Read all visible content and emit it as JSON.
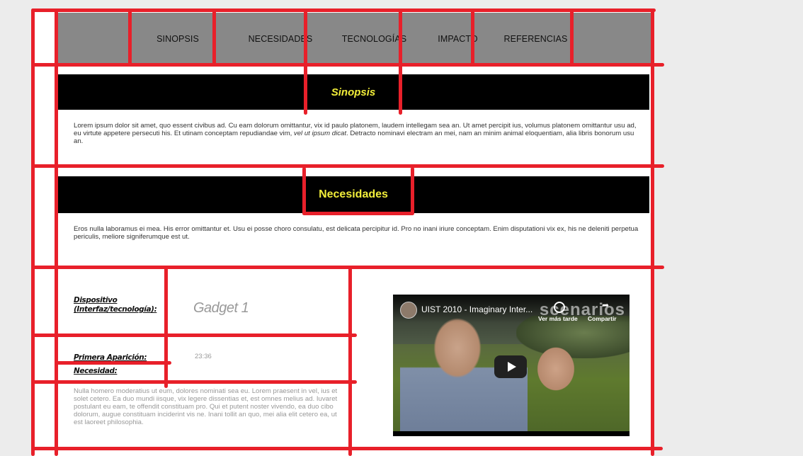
{
  "nav": {
    "items": [
      "SINOPSIS",
      "NECESIDADES",
      "TECNOLOGÍAS",
      "IMPACTO",
      "REFERENCIAS"
    ]
  },
  "sinopsis": {
    "title": "Sinopsis",
    "text_before": "Lorem ipsum dolor sit amet, quo essent civibus ad. Cu eam dolorum omittantur, vix id paulo platonem, laudem intellegam sea an. Ut amet percipit ius, volumus platonem omittantur usu ad, eu virtute appetere persecuti his. Et utinam conceptam repudiandae vim, ",
    "text_em": "vel ut ipsum dicat",
    "text_after": ". Detracto nominavi electram an mei, nam an minim animal eloquentiam, alia libris bonorum usu an."
  },
  "necesidades": {
    "title": "Necesidades",
    "text": "Eros nulla laboramus ei mea. His error omittantur et. Usu ei posse choro consulatu, est delicata percipitur id. Pro no inani iriure conceptam. Enim disputationi vix ex, his ne deleniti perpetua periculis, meliore signiferumque est ut."
  },
  "detail": {
    "dispositivo_label_1": "Dispositivo",
    "dispositivo_label_2": "(Interfaz/tecnología):",
    "dispositivo_value": "Gadget 1",
    "aparicion_label": "Primera Aparición:",
    "aparicion_value": "23:36",
    "necesidad_label": "Necesidad:",
    "necesidad_text": "Nulla homero moderatius ut eum, dolores nominati sea eu. Lorem praesent in vel, ius et solet cetero. Ea duo mundi iisque, vix legere dissentias et, est omnes melius ad. Iuvaret postulant eu eam, te offendit constituam pro. Qui et putent noster vivendo, ea duo cibo dolorum, augue constituam inciderint vis ne. Inani tollit an quo, mei alia elit cetero ea, ut est laoreet philosophia."
  },
  "video": {
    "title": "UIST 2010 - Imaginary Inter...",
    "brand": "scenarios",
    "watch_later": "Ver más tarde",
    "share": "Compartir"
  },
  "colors": {
    "nav_bg": "#888888",
    "bar_bg": "#000000",
    "bar_text": "#f2ee3a",
    "annotation_red": "#e8202a"
  }
}
